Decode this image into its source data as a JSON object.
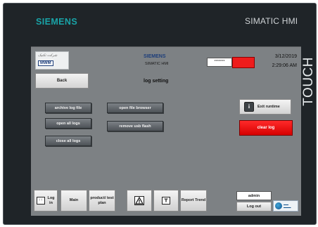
{
  "device": {
    "brand": "SIEMENS",
    "product": "SIMATIC HMI",
    "touch_label": "TOUCH"
  },
  "header": {
    "brand": "SIEMENS",
    "product": "SIMATIC HMI",
    "logo_company": "MWM",
    "password_mask": "*******",
    "date": "3/12/2019",
    "time": "2:29:06 AM",
    "status_color": "#ee1c1c"
  },
  "page": {
    "title": "log setting",
    "back_label": "Back"
  },
  "actions": {
    "archive_log_file": "archive log file",
    "open_file_browser": "open file browser",
    "open_all_logs": "open all logs",
    "remove_usb_flash": "remove usb flash",
    "close_all_logs": "close all logs",
    "exit_runtime": "Exit runtime",
    "clear_log": "clear log"
  },
  "nav": {
    "log_in": "Log in",
    "main": "Main",
    "product_test_plan": "product/ test plan",
    "report_trend": "Report Trend",
    "user": "admin",
    "log_out": "Log out"
  },
  "icons": {
    "login": "login-icon",
    "warning": "warning-icon",
    "alarm": "alarm-icon",
    "exit": "info-icon"
  }
}
